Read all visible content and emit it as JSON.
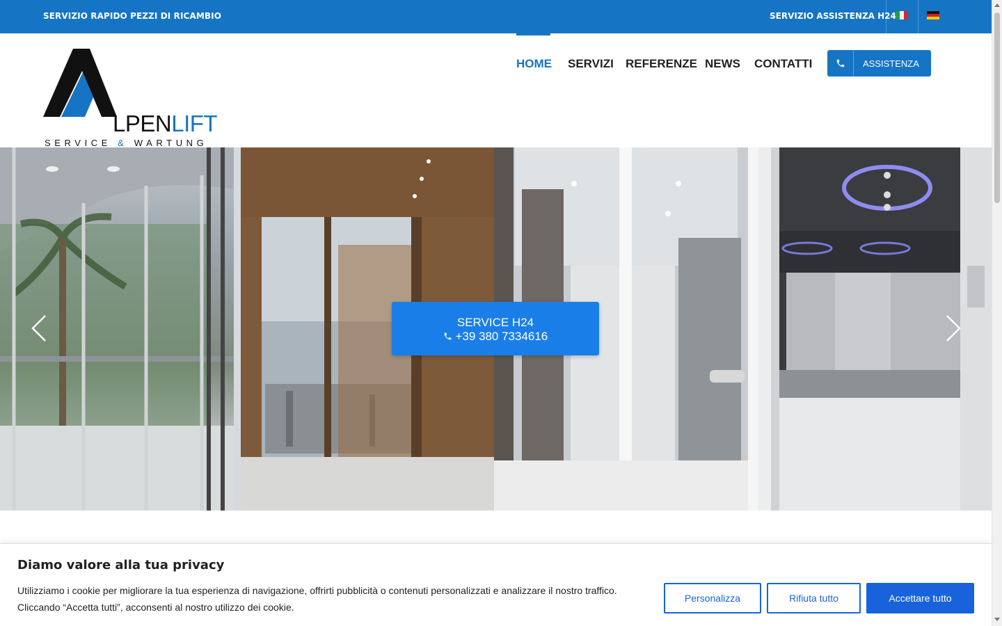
{
  "topbar": {
    "left_text": "SERVIZIO RAPIDO PEZZI DI RICAMBIO",
    "right_text": "SERVIZIO ASSISTENZA H24",
    "languages": [
      "it-flag-icon",
      "de-flag-icon"
    ]
  },
  "logo": {
    "word_main": "LPEN",
    "word_accent": "LIFT",
    "tagline_a": "SERVICE ",
    "tagline_amp": "&",
    "tagline_b": " WARTUNG"
  },
  "nav": {
    "items": [
      {
        "label": "HOME",
        "active": true
      },
      {
        "label": "SERVIZI",
        "active": false
      },
      {
        "label": "REFERENZE",
        "active": false
      },
      {
        "label": "NEWS",
        "active": false
      },
      {
        "label": "CONTATTI",
        "active": false
      }
    ],
    "assist_label": "ASSISTENZA",
    "assist_icon": "phone-icon"
  },
  "hero": {
    "cta_line1": "SERVICE H24",
    "cta_phone": "+39 380 7334616",
    "prev_icon": "chevron-left-icon",
    "next_icon": "chevron-right-icon"
  },
  "cookie": {
    "title": "Diamo valore alla tua privacy",
    "text": "Utilizziamo i cookie per migliorare la tua esperienza di navigazione, offrirti pubblicità o contenuti personalizzati e analizzare il nostro traffico. Cliccando “Accetta tutti”, acconsenti al nostro utilizzo dei cookie.",
    "btn_customize": "Personalizza",
    "btn_reject": "Rifiuta tutto",
    "btn_accept": "Accettare tutto"
  },
  "colors": {
    "brand": "#1574c4",
    "cta": "#1a7ee8",
    "cookie_accent": "#1863dc"
  }
}
